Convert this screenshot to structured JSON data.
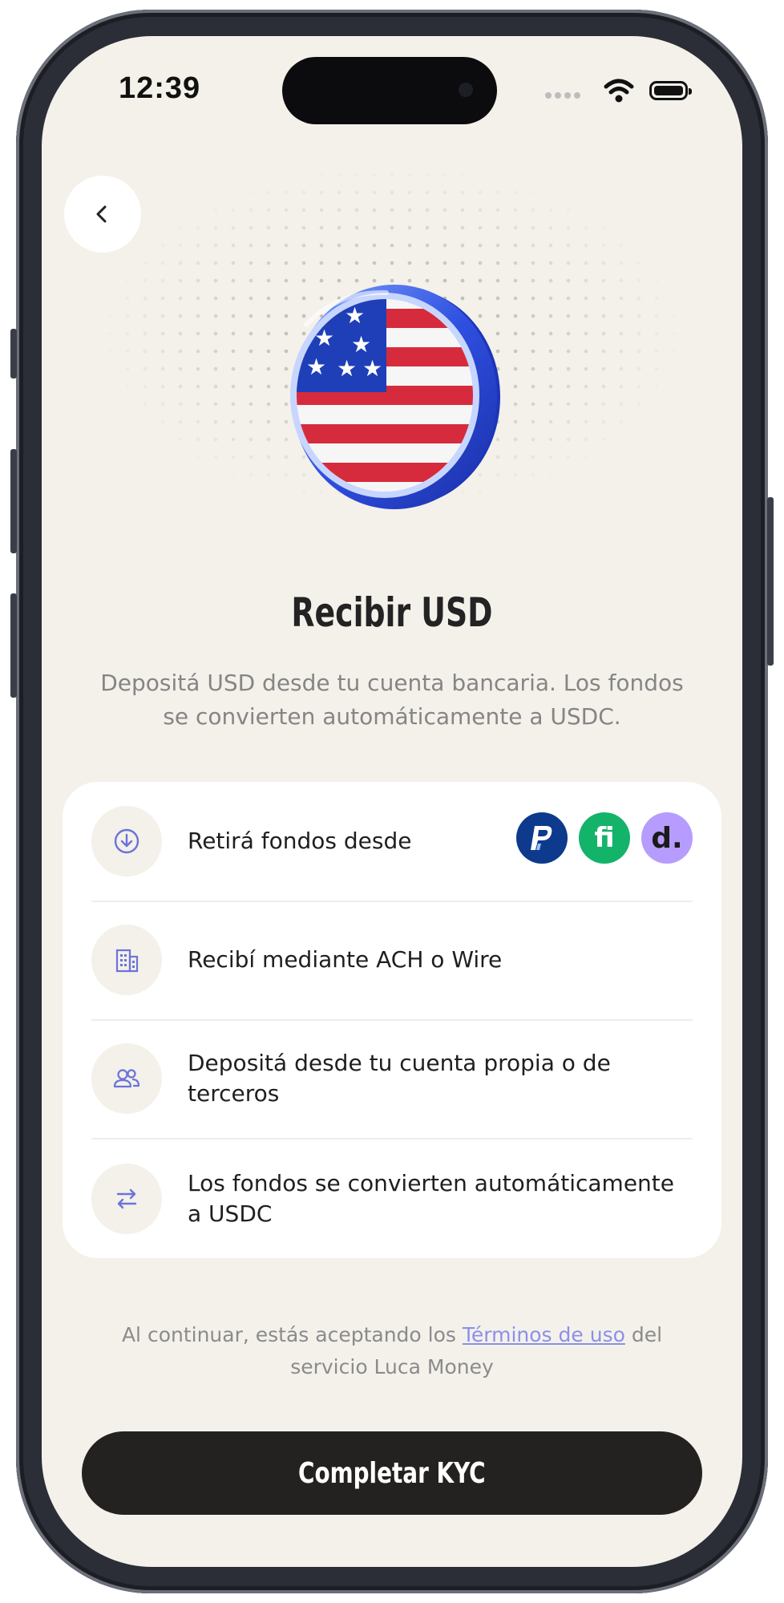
{
  "status_bar": {
    "time": "12:39"
  },
  "screen": {
    "title": "Recibir USD",
    "subtitle": "Depositá USD desde tu cuenta bancaria. Los fondos se convierten automáticamente a USDC."
  },
  "icons": {
    "back": "chevron-left-icon",
    "hero": "us-flag-coin-icon",
    "row_icons": [
      "download-circle-icon",
      "building-icon",
      "users-icon",
      "arrows-exchange-icon"
    ],
    "brand_logos": [
      "paypal-logo",
      "fiat-fi-logo",
      "deel-logo"
    ]
  },
  "features": [
    {
      "label": "Retirá fondos desde"
    },
    {
      "label": "Recibí mediante ACH o Wire"
    },
    {
      "label": "Depositá desde tu cuenta propia o de terceros"
    },
    {
      "label": "Los fondos se convierten automáticamente a USDC"
    }
  ],
  "brand_logo_text": {
    "fiat": "fi",
    "deel": "d."
  },
  "legal": {
    "prefix": "Al continuar, estás aceptando los ",
    "link": "Términos de uso",
    "suffix": " del servicio Luca Money"
  },
  "cta": {
    "label": "Completar KYC"
  },
  "colors": {
    "background": "#f4f1eb",
    "card": "#ffffff",
    "primary_button": "#242220",
    "accent_icon": "#6b73d9",
    "link": "#8b90e8"
  }
}
